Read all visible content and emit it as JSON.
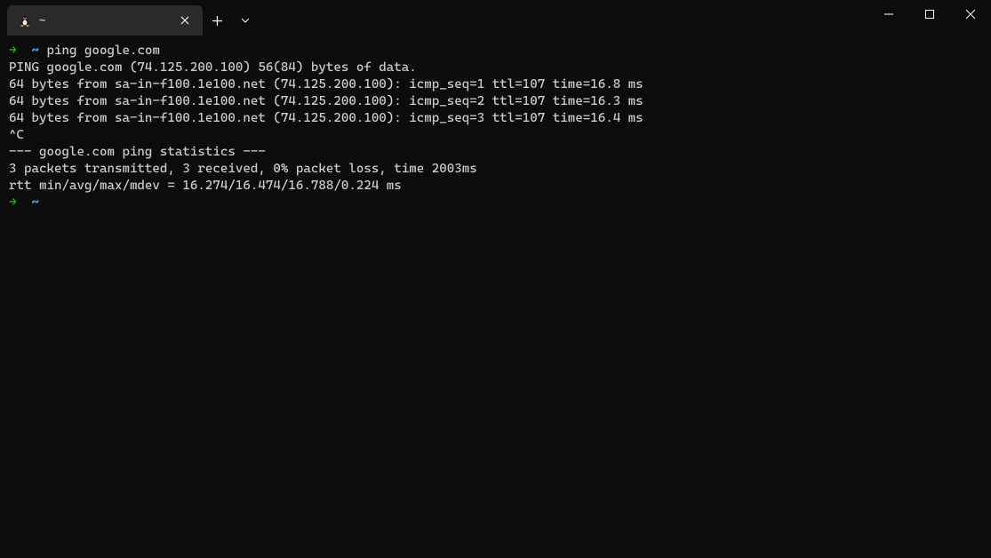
{
  "tab": {
    "title": "~"
  },
  "terminal": {
    "prompt1": {
      "arrow": "→",
      "path": "~",
      "command": "ping google.com"
    },
    "output": [
      "PING google.com (74.125.200.100) 56(84) bytes of data.",
      "64 bytes from sa-in-f100.1e100.net (74.125.200.100): icmp_seq=1 ttl=107 time=16.8 ms",
      "64 bytes from sa-in-f100.1e100.net (74.125.200.100): icmp_seq=2 ttl=107 time=16.3 ms",
      "64 bytes from sa-in-f100.1e100.net (74.125.200.100): icmp_seq=3 ttl=107 time=16.4 ms",
      "^C",
      "--- google.com ping statistics ---",
      "3 packets transmitted, 3 received, 0% packet loss, time 2003ms",
      "rtt min/avg/max/mdev = 16.274/16.474/16.788/0.224 ms"
    ],
    "prompt2": {
      "arrow": "→",
      "path": "~"
    }
  }
}
